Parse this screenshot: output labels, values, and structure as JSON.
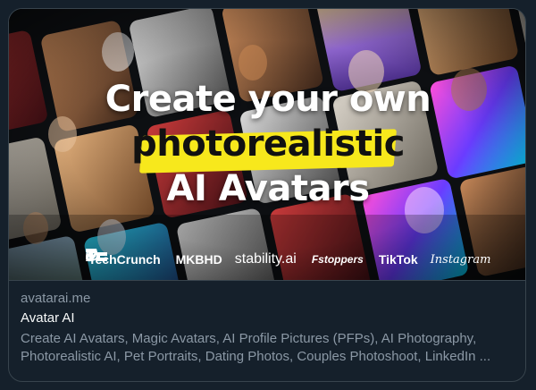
{
  "card": {
    "domain": "avatarai.me",
    "title": "Avatar AI",
    "description_line1": "Create AI Avatars, Magic Avatars, AI Profile Pictures (PFPs), AI Photography,",
    "description_line2": "Photorealistic AI, Pet Portraits, Dating Photos, Couples Photoshoot, LinkedIn ..."
  },
  "banner": {
    "line1": "Create your own",
    "line2": "photorealistic",
    "line3": "AI Avatars",
    "highlight_color": "#f7e81c",
    "logos": [
      {
        "name": "techcrunch-logo",
        "text": "TechCrunch"
      },
      {
        "name": "mkbhd-logo",
        "text": "MKBHD"
      },
      {
        "name": "stability-logo",
        "text": "stability.ai"
      },
      {
        "name": "fstoppers-logo",
        "text": "Fstoppers"
      },
      {
        "name": "tiktok-logo",
        "text": "TikTok"
      },
      {
        "name": "instagram-logo",
        "text": "Instagram"
      }
    ]
  },
  "colors": {
    "background": "#15202b",
    "border": "#38444d",
    "secondary_text": "#8b98a5",
    "primary_text": "#f7f9f9"
  }
}
